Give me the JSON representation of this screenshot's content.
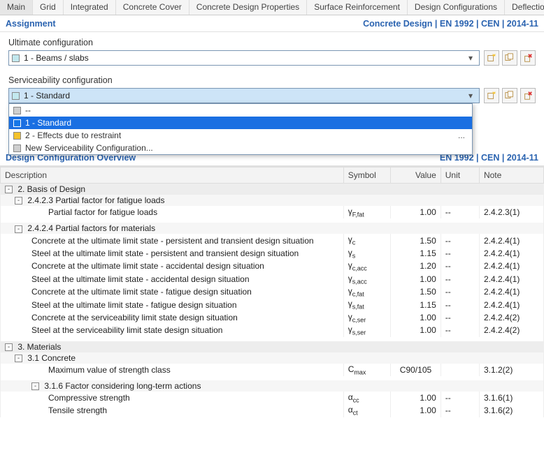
{
  "tabs": [
    "Main",
    "Grid",
    "Integrated",
    "Concrete Cover",
    "Concrete Design Properties",
    "Surface Reinforcement",
    "Design Configurations",
    "Deflection"
  ],
  "assignment": {
    "title": "Assignment",
    "standard_label": "Concrete Design | EN 1992 | CEN | 2014-11",
    "ultimate_label": "Ultimate configuration",
    "ultimate_value": "1 - Beams / slabs",
    "ultimate_swatch": "#c2e8ee",
    "serviceability_label": "Serviceability configuration",
    "serviceability_value": "1 - Standard",
    "serviceability_swatch": "#c2e8ee",
    "dropdown": [
      {
        "label": "--",
        "swatch": "#cfcfcf"
      },
      {
        "label": "1 - Standard",
        "swatch": "#1577e8",
        "selected": true
      },
      {
        "label": "2 - Effects due to restraint",
        "swatch": "#f4c22b",
        "dots": "..."
      },
      {
        "label": "New Serviceability Configuration...",
        "swatch": "#cfcfcf"
      }
    ]
  },
  "overview": {
    "title": "Design Configuration Overview",
    "standard_label": "EN 1992 | CEN | 2014-11",
    "columns": {
      "desc": "Description",
      "symbol": "Symbol",
      "value": "Value",
      "unit": "Unit",
      "note": "Note"
    },
    "rows": [
      {
        "type": "group",
        "indent": 0,
        "desc": "2. Basis of Design",
        "toggle": "-"
      },
      {
        "type": "subgroup",
        "indent": 1,
        "desc": "2.4.2.3 Partial factor for fatigue loads",
        "toggle": "-"
      },
      {
        "type": "row",
        "indent": 3,
        "desc": "Partial factor for fatigue loads",
        "symbol": "γF,fat",
        "value": "1.00",
        "unit": "--",
        "note": "2.4.2.3(1)"
      },
      {
        "type": "blank"
      },
      {
        "type": "subgroup",
        "indent": 1,
        "desc": "2.4.2.4 Partial factors for materials",
        "toggle": "-"
      },
      {
        "type": "row",
        "indent": 2,
        "desc": "Concrete at the ultimate limit state - persistent and transient design situation",
        "symbol": "γc",
        "value": "1.50",
        "unit": "--",
        "note": "2.4.2.4(1)"
      },
      {
        "type": "row",
        "indent": 2,
        "desc": "Steel at the ultimate limit state - persistent and transient design situation",
        "symbol": "γs",
        "value": "1.15",
        "unit": "--",
        "note": "2.4.2.4(1)"
      },
      {
        "type": "row",
        "indent": 2,
        "desc": "Concrete at the ultimate limit state - accidental design situation",
        "symbol": "γc,acc",
        "value": "1.20",
        "unit": "--",
        "note": "2.4.2.4(1)"
      },
      {
        "type": "row",
        "indent": 2,
        "desc": "Steel at the ultimate limit state - accidental design situation",
        "symbol": "γs,acc",
        "value": "1.00",
        "unit": "--",
        "note": "2.4.2.4(1)"
      },
      {
        "type": "row",
        "indent": 2,
        "desc": "Concrete at the ultimate limit state - fatigue design situation",
        "symbol": "γc,fat",
        "value": "1.50",
        "unit": "--",
        "note": "2.4.2.4(1)"
      },
      {
        "type": "row",
        "indent": 2,
        "desc": "Steel at the ultimate limit state - fatigue design situation",
        "symbol": "γs,fat",
        "value": "1.15",
        "unit": "--",
        "note": "2.4.2.4(1)"
      },
      {
        "type": "row",
        "indent": 2,
        "desc": "Concrete at the serviceability limit state design situation",
        "symbol": "γc,ser",
        "value": "1.00",
        "unit": "--",
        "note": "2.4.2.4(2)"
      },
      {
        "type": "row",
        "indent": 2,
        "desc": "Steel at the serviceability limit state design situation",
        "symbol": "γs,ser",
        "value": "1.00",
        "unit": "--",
        "note": "2.4.2.4(2)"
      },
      {
        "type": "blank"
      },
      {
        "type": "group",
        "indent": 0,
        "desc": "3. Materials",
        "toggle": "-"
      },
      {
        "type": "subgroup",
        "indent": 1,
        "desc": "3.1 Concrete",
        "toggle": "-"
      },
      {
        "type": "row",
        "indent": 3,
        "desc": "Maximum value of strength class",
        "symbol": "Cmax",
        "value": "C90/105",
        "valAlign": "center",
        "unit": "",
        "note": "3.1.2(2)"
      },
      {
        "type": "blank"
      },
      {
        "type": "subgroup",
        "indent": 2,
        "desc": "3.1.6 Factor considering long-term actions",
        "toggle": "-"
      },
      {
        "type": "row",
        "indent": 3,
        "desc": "Compressive strength",
        "symbol": "αcc",
        "value": "1.00",
        "unit": "--",
        "note": "3.1.6(1)"
      },
      {
        "type": "row",
        "indent": 3,
        "desc": "Tensile strength",
        "symbol": "αct",
        "value": "1.00",
        "unit": "--",
        "note": "3.1.6(2)"
      }
    ]
  }
}
